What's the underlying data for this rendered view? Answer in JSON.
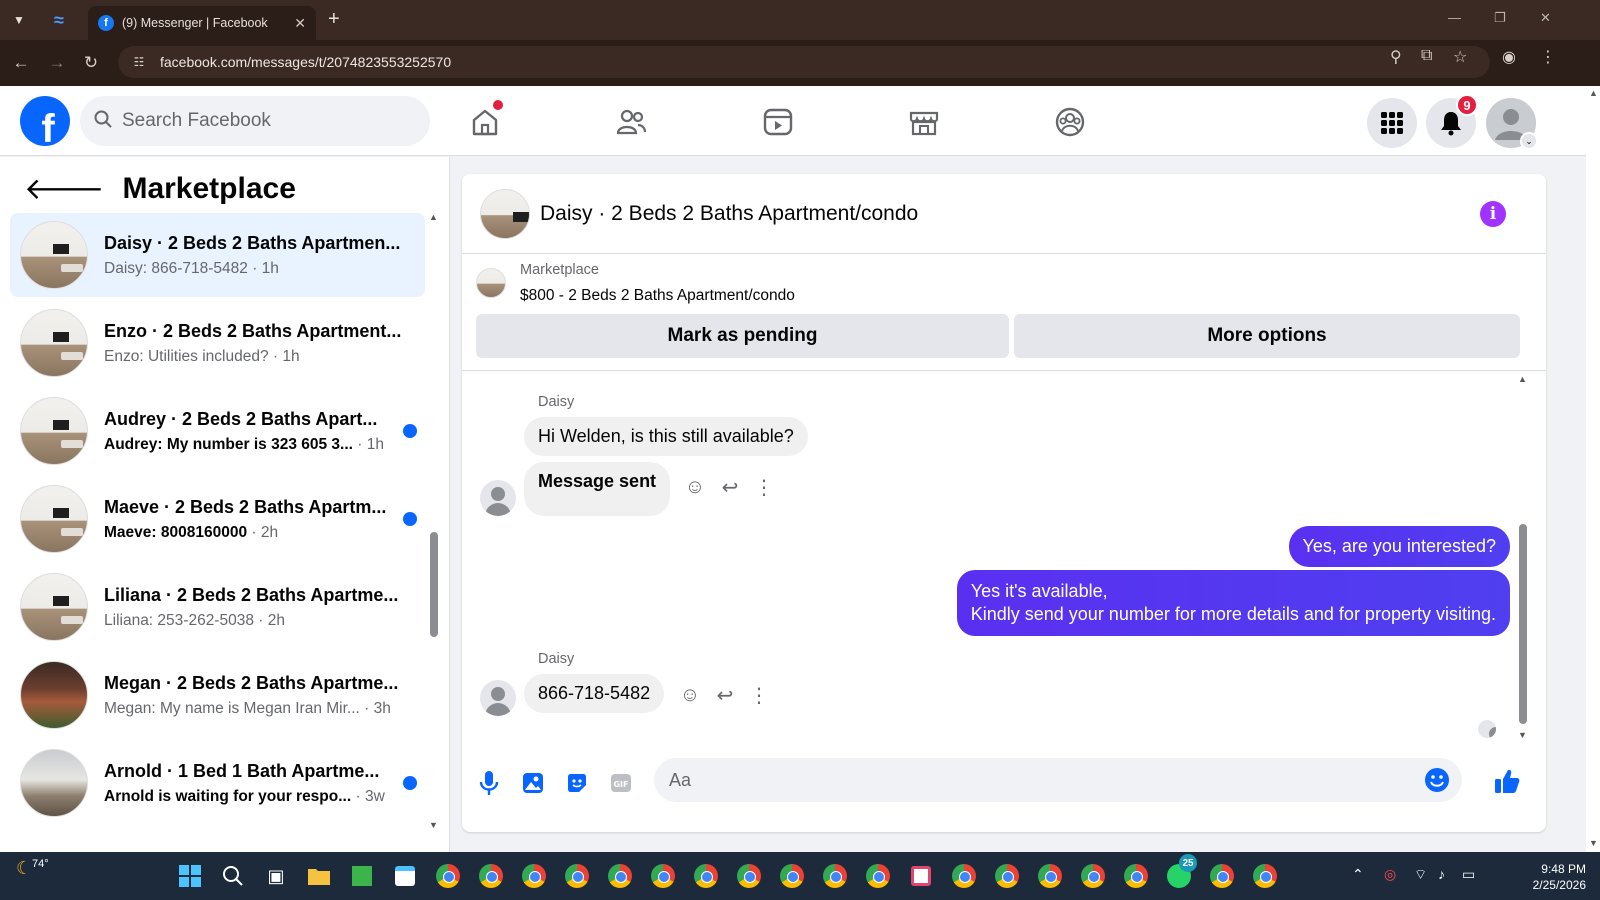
{
  "browser": {
    "tab_title": "(9) Messenger | Facebook",
    "url": "facebook.com/messages/t/2074823553252570"
  },
  "fb": {
    "search_placeholder": "Search Facebook",
    "notifications_count": "9"
  },
  "sidebar": {
    "title": "Marketplace",
    "conversations": [
      {
        "name": "Daisy · 2 Beds 2 Baths Apartmen...",
        "preview": "Daisy: 866-718-5482",
        "time": " · 1h",
        "unread": false,
        "active": true
      },
      {
        "name": "Enzo · 2 Beds 2 Baths Apartment...",
        "preview": "Enzo: Utilities included?",
        "time": " · 1h",
        "unread": false
      },
      {
        "name": "Audrey · 2 Beds 2 Baths Apart...",
        "preview": "Audrey: My number is 323 605 3...",
        "time": " · 1h",
        "unread": true
      },
      {
        "name": "Maeve · 2 Beds 2 Baths Apartm...",
        "preview": "Maeve: 8008160000",
        "time": " · 2h",
        "unread": true
      },
      {
        "name": "Liliana · 2 Beds 2 Baths Apartme...",
        "preview": "Liliana: 253-262-5038",
        "time": " · 2h",
        "unread": false
      },
      {
        "name": "Megan · 2 Beds 2 Baths Apartme...",
        "preview": "Megan: My name is Megan Iran Mir...",
        "time": " · 3h",
        "unread": false
      },
      {
        "name": "Arnold · 1 Bed 1 Bath Apartme...",
        "preview": "Arnold is waiting for your respo...",
        "time": " · 3w",
        "unread": true
      }
    ]
  },
  "chat": {
    "title": "Daisy · 2 Beds 2 Baths Apartment/condo",
    "listing_source": "Marketplace",
    "listing_title": "$800 - 2 Beds 2 Baths Apartment/condo",
    "mark_pending_label": "Mark as pending",
    "more_options_label": "More options",
    "messages": [
      {
        "sender": "Daisy",
        "text": "Hi Welden, is this still available?"
      },
      {
        "text": "Message sent"
      },
      {
        "text": "Yes, are you interested?"
      },
      {
        "text_line1": "Yes it's available,",
        "text_line2": "Kindly send your number for more details and for property visiting."
      },
      {
        "sender": "Daisy",
        "text": "866-718-5482"
      }
    ],
    "composer_placeholder": "Aa"
  },
  "taskbar": {
    "weather": "74°",
    "time": "9:48 PM",
    "date": "2/25/2026",
    "whatsapp_badge": "25"
  }
}
